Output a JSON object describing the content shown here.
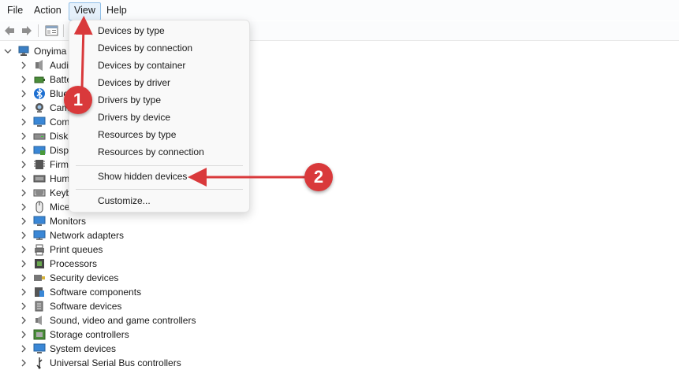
{
  "menubar": {
    "items": [
      "File",
      "Action",
      "View",
      "Help"
    ]
  },
  "tree": {
    "root": "Onyima",
    "items": [
      {
        "label": "Audi",
        "icon": "speaker-icon"
      },
      {
        "label": "Batte",
        "icon": "battery-icon"
      },
      {
        "label": "Blue",
        "icon": "bluetooth-icon"
      },
      {
        "label": "Cam",
        "icon": "camera-icon"
      },
      {
        "label": "Com",
        "icon": "computer-icon"
      },
      {
        "label": "Disk",
        "icon": "disk-drive-icon"
      },
      {
        "label": "Disp",
        "icon": "display-adapter-icon"
      },
      {
        "label": "Firm",
        "icon": "firmware-icon"
      },
      {
        "label": "Hum",
        "icon": "hid-icon"
      },
      {
        "label": "Keyb",
        "icon": "keyboard-icon"
      },
      {
        "label": "Mice",
        "icon": "mouse-icon"
      },
      {
        "label": "Monitors",
        "icon": "monitor-icon"
      },
      {
        "label": "Network adapters",
        "icon": "network-adapter-icon"
      },
      {
        "label": "Print queues",
        "icon": "printer-icon"
      },
      {
        "label": "Processors",
        "icon": "processor-icon"
      },
      {
        "label": "Security devices",
        "icon": "security-device-icon"
      },
      {
        "label": "Software components",
        "icon": "software-component-icon"
      },
      {
        "label": "Software devices",
        "icon": "software-device-icon"
      },
      {
        "label": "Sound, video and game controllers",
        "icon": "sound-icon"
      },
      {
        "label": "Storage controllers",
        "icon": "storage-controller-icon"
      },
      {
        "label": "System devices",
        "icon": "system-device-icon"
      },
      {
        "label": "Universal Serial Bus controllers",
        "icon": "usb-icon"
      }
    ]
  },
  "view_menu": {
    "items": [
      "Devices by type",
      "Devices by connection",
      "Devices by container",
      "Devices by driver",
      "Drivers by type",
      "Drivers by device",
      "Resources by type",
      "Resources by connection"
    ],
    "show_hidden": "Show hidden devices",
    "customize": "Customize..."
  },
  "annotations": {
    "badge1": "1",
    "badge2": "2"
  },
  "colors": {
    "annotation_red": "#d9393b",
    "menu_highlight": "#e6f1fb"
  }
}
